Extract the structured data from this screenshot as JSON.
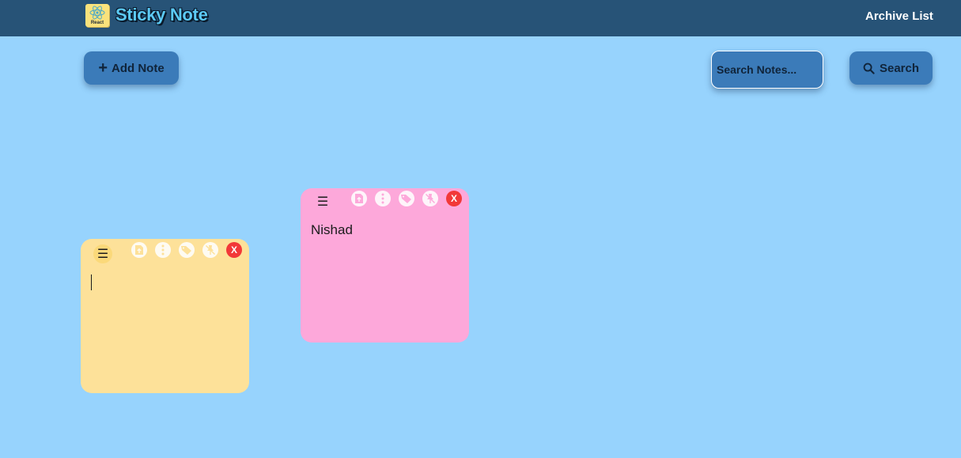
{
  "navbar": {
    "logo_text": "React",
    "brand_title": "Sticky Note",
    "archive_link": "Archive List"
  },
  "toolbar": {
    "add_note_label": "Add Note",
    "search_placeholder": "Search Notes...",
    "search_value": "",
    "search_button_label": "Search"
  },
  "notes": [
    {
      "color": "#fde199",
      "text": "",
      "tools": [
        "upload-file-icon",
        "more-options-icon",
        "tag-icon",
        "unpin-icon"
      ],
      "close_label": "X"
    },
    {
      "color": "#fda8da",
      "text": "Nishad",
      "tools": [
        "upload-file-icon",
        "more-options-icon",
        "tag-icon",
        "unpin-icon"
      ],
      "close_label": "X"
    }
  ],
  "colors": {
    "background": "#97d3fd",
    "navbar": "#275377",
    "button": "#3b7bb9",
    "close": "#f23838"
  }
}
